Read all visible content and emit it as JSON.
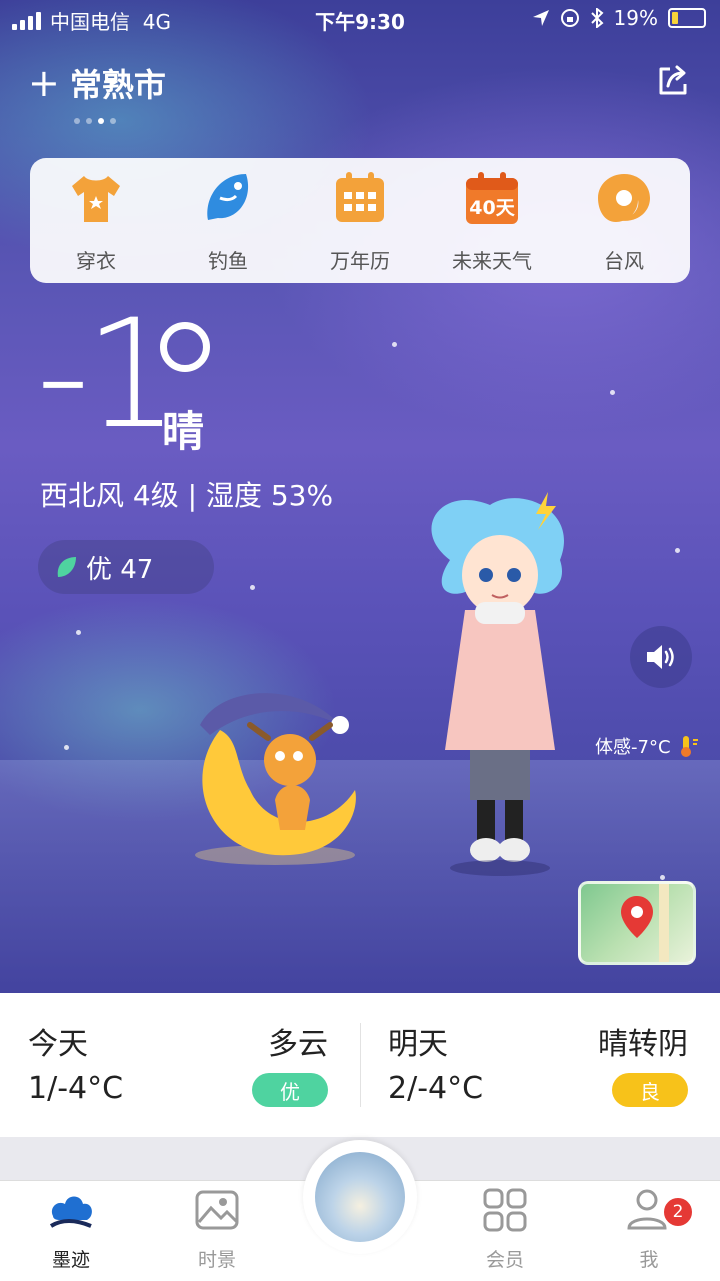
{
  "status_bar": {
    "carrier": "中国电信",
    "network": "4G",
    "time": "下午9:30",
    "battery": "19%"
  },
  "header": {
    "city": "常熟市",
    "page_dots": 4,
    "active_dot": 3,
    "share_icon": "share-icon"
  },
  "shortcuts": [
    {
      "label": "穿衣",
      "icon": "shirt-icon",
      "color": "#f3a23a"
    },
    {
      "label": "钓鱼",
      "icon": "fish-icon",
      "color": "#2f8ce0"
    },
    {
      "label": "万年历",
      "icon": "calendar-icon",
      "color": "#f3a23a"
    },
    {
      "label": "未来天气",
      "icon": "forecast-40-icon",
      "text": "40天",
      "color": "#f07a2a"
    },
    {
      "label": "台风",
      "icon": "typhoon-icon",
      "color": "#f3a23a"
    }
  ],
  "current": {
    "temperature": "-1",
    "condition": "晴",
    "wind_humidity": "西北风 4级 | 湿度 53%",
    "aqi_label": "优 47",
    "feels_like": "体感-7°C"
  },
  "forecast": {
    "today": {
      "day": "今天",
      "weather": "多云",
      "range": "1/-4°C",
      "aqi": "优",
      "aqi_color": "#4fd3a0"
    },
    "tomorrow": {
      "day": "明天",
      "weather": "晴转阴",
      "range": "2/-4°C",
      "aqi": "良",
      "aqi_color": "#f7c21a"
    }
  },
  "nav": {
    "items": [
      {
        "label": "墨迹",
        "icon": "moji-cloud-icon"
      },
      {
        "label": "时景",
        "icon": "photo-icon"
      },
      {
        "label": "会员",
        "icon": "grid-icon"
      },
      {
        "label": "我",
        "icon": "profile-icon"
      }
    ],
    "badge": "2"
  }
}
